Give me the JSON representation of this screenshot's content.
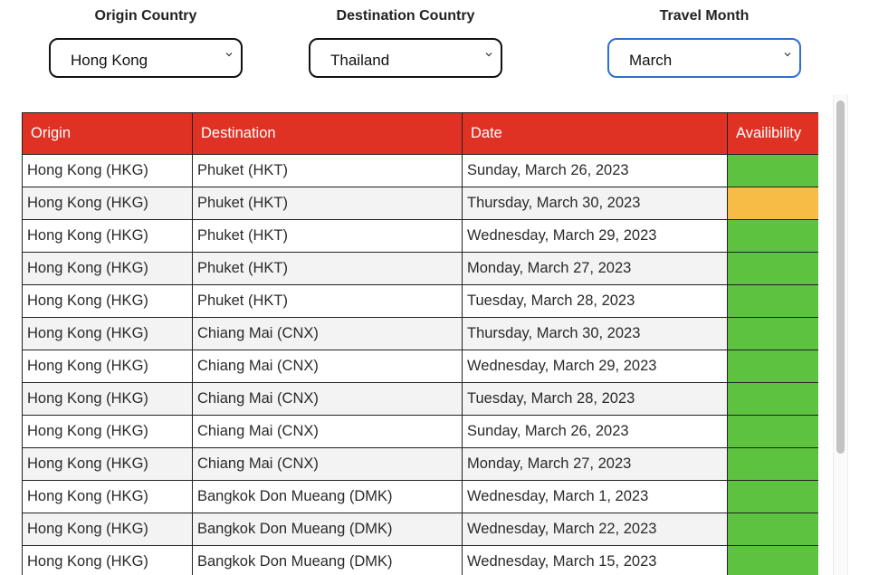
{
  "filters": [
    {
      "label": "Origin Country",
      "value": "Hong Kong",
      "focused": false
    },
    {
      "label": "Destination Country",
      "value": "Thailand",
      "focused": false
    },
    {
      "label": "Travel Month",
      "value": "March",
      "focused": true
    }
  ],
  "colors": {
    "header": "#e03224",
    "available": "#5cc23f",
    "limited": "#f6bc45",
    "focus": "#2f6fd0"
  },
  "table": {
    "headers": [
      "Origin",
      "Destination",
      "Date",
      "Availibility"
    ],
    "rows": [
      {
        "origin": "Hong Kong (HKG)",
        "destination": "Phuket (HKT)",
        "date": "Sunday, March 26, 2023",
        "availability": "green"
      },
      {
        "origin": "Hong Kong (HKG)",
        "destination": "Phuket (HKT)",
        "date": "Thursday, March 30, 2023",
        "availability": "amber"
      },
      {
        "origin": "Hong Kong (HKG)",
        "destination": "Phuket (HKT)",
        "date": "Wednesday, March 29, 2023",
        "availability": "green"
      },
      {
        "origin": "Hong Kong (HKG)",
        "destination": "Phuket (HKT)",
        "date": "Monday, March 27, 2023",
        "availability": "green"
      },
      {
        "origin": "Hong Kong (HKG)",
        "destination": "Phuket (HKT)",
        "date": "Tuesday, March 28, 2023",
        "availability": "green"
      },
      {
        "origin": "Hong Kong (HKG)",
        "destination": "Chiang Mai (CNX)",
        "date": "Thursday, March 30, 2023",
        "availability": "green"
      },
      {
        "origin": "Hong Kong (HKG)",
        "destination": "Chiang Mai (CNX)",
        "date": "Wednesday, March 29, 2023",
        "availability": "green"
      },
      {
        "origin": "Hong Kong (HKG)",
        "destination": "Chiang Mai (CNX)",
        "date": "Tuesday, March 28, 2023",
        "availability": "green"
      },
      {
        "origin": "Hong Kong (HKG)",
        "destination": "Chiang Mai (CNX)",
        "date": "Sunday, March 26, 2023",
        "availability": "green"
      },
      {
        "origin": "Hong Kong (HKG)",
        "destination": "Chiang Mai (CNX)",
        "date": "Monday, March 27, 2023",
        "availability": "green"
      },
      {
        "origin": "Hong Kong (HKG)",
        "destination": "Bangkok Don Mueang (DMK)",
        "date": "Wednesday, March 1, 2023",
        "availability": "green"
      },
      {
        "origin": "Hong Kong (HKG)",
        "destination": "Bangkok Don Mueang (DMK)",
        "date": "Wednesday, March 22, 2023",
        "availability": "green"
      },
      {
        "origin": "Hong Kong (HKG)",
        "destination": "Bangkok Don Mueang (DMK)",
        "date": "Wednesday, March 15, 2023",
        "availability": "green"
      }
    ]
  }
}
